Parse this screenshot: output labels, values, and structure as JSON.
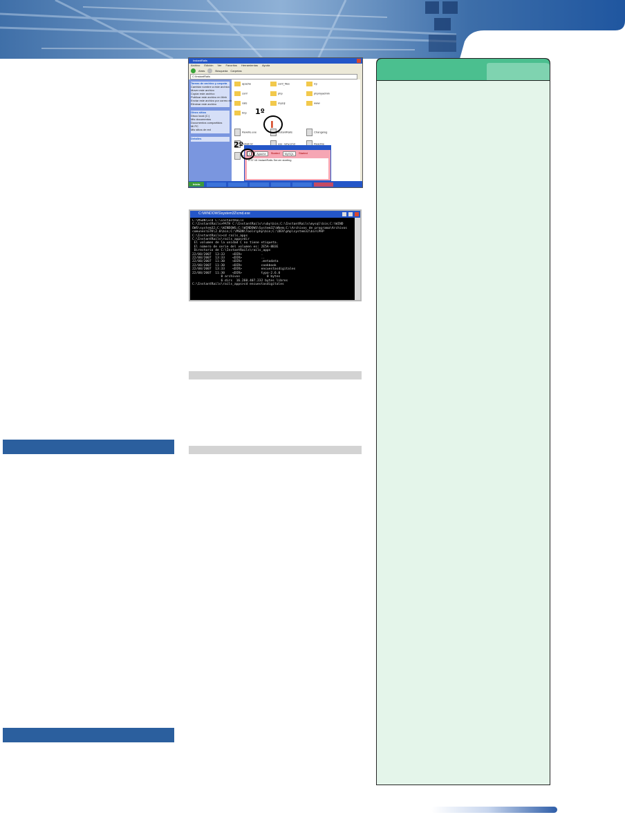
{
  "explorer_window": {
    "title": "InstantRails",
    "address": "C:\\InstantRails",
    "menu_items": [
      "Archivo",
      "Edición",
      "Ver",
      "Favoritos",
      "Herramientas",
      "Ayuda"
    ],
    "toolbar_back": "Atrás",
    "toolbar_search": "Búsqueda",
    "toolbar_folders": "Carpetas",
    "task_panel_title": "Tareas de archivo y carpeta",
    "task_items": [
      "Cambiar nombre a este archivo",
      "Mover este archivo",
      "Copiar este archivo",
      "Publicar este archivo en Web",
      "Enviar este archivo por correo electrónico",
      "Eliminar este archivo"
    ],
    "other_places_title": "Otros sitios",
    "other_places": [
      "Disco local (C:)",
      "Mis documentos",
      "Documentos compartidos",
      "Mi PC",
      "Mis sitios de red"
    ],
    "details_title": "Detalles",
    "folders": [
      "apache",
      "conf",
      "cgi",
      "rrp",
      "conf_files",
      "php",
      "rails",
      "www",
      "mysql",
      "phpmyadmin",
      "tmp"
    ],
    "files": [
      "Rewrite.exe",
      "InstantRails",
      "Changelog",
      "install.txt",
      "use_ruby.cmd",
      "Readme",
      "Instantrails",
      "InstantRails",
      "use_ruby"
    ],
    "annotation_first": "1º",
    "annotation_second": "2º",
    "instantrails_dialog_title": "InstantRails",
    "instantrails_button_i": "I",
    "instantrails_apache_label": "Apache",
    "instantrails_apache_status": "Started",
    "instantrails_mysql_label": "MySQL",
    "instantrails_mysql_status": "Started",
    "instantrails_log_line": "2:37:16 InstantRails Server starting",
    "taskbar_start": "Inicio"
  },
  "cmd_window": {
    "title": "C:\\WINDOWS\\system32\\cmd.exe",
    "lines": [
      "C:\\MSDN\\>cd C:\\InstantRails",
      "",
      "C:\\InstantRails>PATH C:\\InstantRails\\ruby\\bin;C:\\InstantRails\\mysql\\bin;C:\\WIND",
      "OWS\\system32;C:\\WINDOWS;C:\\WINDOWS\\System32\\Wbem;C:\\Archivos de programa\\Archivos",
      "comunes\\GTK\\2.0\\bin;C:\\MSDN\\Tools\\php\\bin;C:\\DEV\\php\\system32\\bin\\PHP",
      "",
      "C:\\InstantRails>cd rails_apps",
      "",
      "C:\\InstantRails\\rails_apps>dir",
      " El volumen de la unidad C no tiene etiqueta.",
      " El número de serie del volumen es: 2E5A-8B3E",
      "",
      " Directorio de C:\\InstantRails\\rails_apps",
      "",
      "22/08/2007  13:33    <DIR>          .",
      "22/08/2007  13:33    <DIR>          ..",
      "22/08/2007  11:30    <DIR>          .metadata",
      "22/08/2007  11:30    <DIR>          cookbook",
      "22/08/2007  13:33    <DIR>          encuestasdigitales",
      "22/08/2007  11:30    <DIR>          typo-2.6.0",
      "               0 archivos              0 bytes",
      "               6 dirs  16.260.407.232 bytes libres",
      "",
      "C:\\InstantRails\\rails_apps>cd encuestasdigitales"
    ]
  },
  "colors": {
    "section_bar": "#2b5f9e",
    "sidebar_fill": "#e4f5ea",
    "sidebar_tab": "#4bbf8f",
    "sidebar_tab_light": "#7fd3b0",
    "gray_bar": "#d3d3d3"
  }
}
